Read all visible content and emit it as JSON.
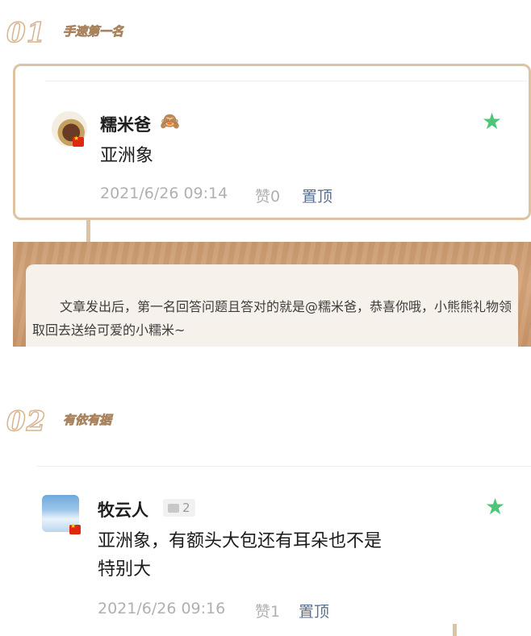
{
  "section1": {
    "number": "01",
    "title": "手速第一名"
  },
  "comment1": {
    "username": "糯米爸",
    "emoji": "🙈",
    "text": "亚洲象",
    "date": "2021/6/26 09:14",
    "likes": "赞0",
    "pin": "置顶"
  },
  "note": {
    "text": "文章发出后，第一名回答问题且答对的就是@糯米爸，恭喜你哦，小熊熊礼物领取回去送给可爱的小糯米~"
  },
  "section2": {
    "number": "02",
    "title": "有依有据"
  },
  "comment2": {
    "username": "牧云人",
    "badge_count": "2",
    "text_line1": "亚洲象，有额头大包还有耳朵也不是",
    "text_line2": "特别大",
    "date": "2021/6/26 09:16",
    "likes": "赞1",
    "pin": "置顶"
  },
  "colors": {
    "accent_border": "#dcc3a2",
    "star": "#4cc777",
    "pin": "#5b6f8f",
    "meta": "#b0b0b0"
  },
  "icons": [
    "star-icon",
    "comment-bubble-icon",
    "china-flag-icon"
  ]
}
